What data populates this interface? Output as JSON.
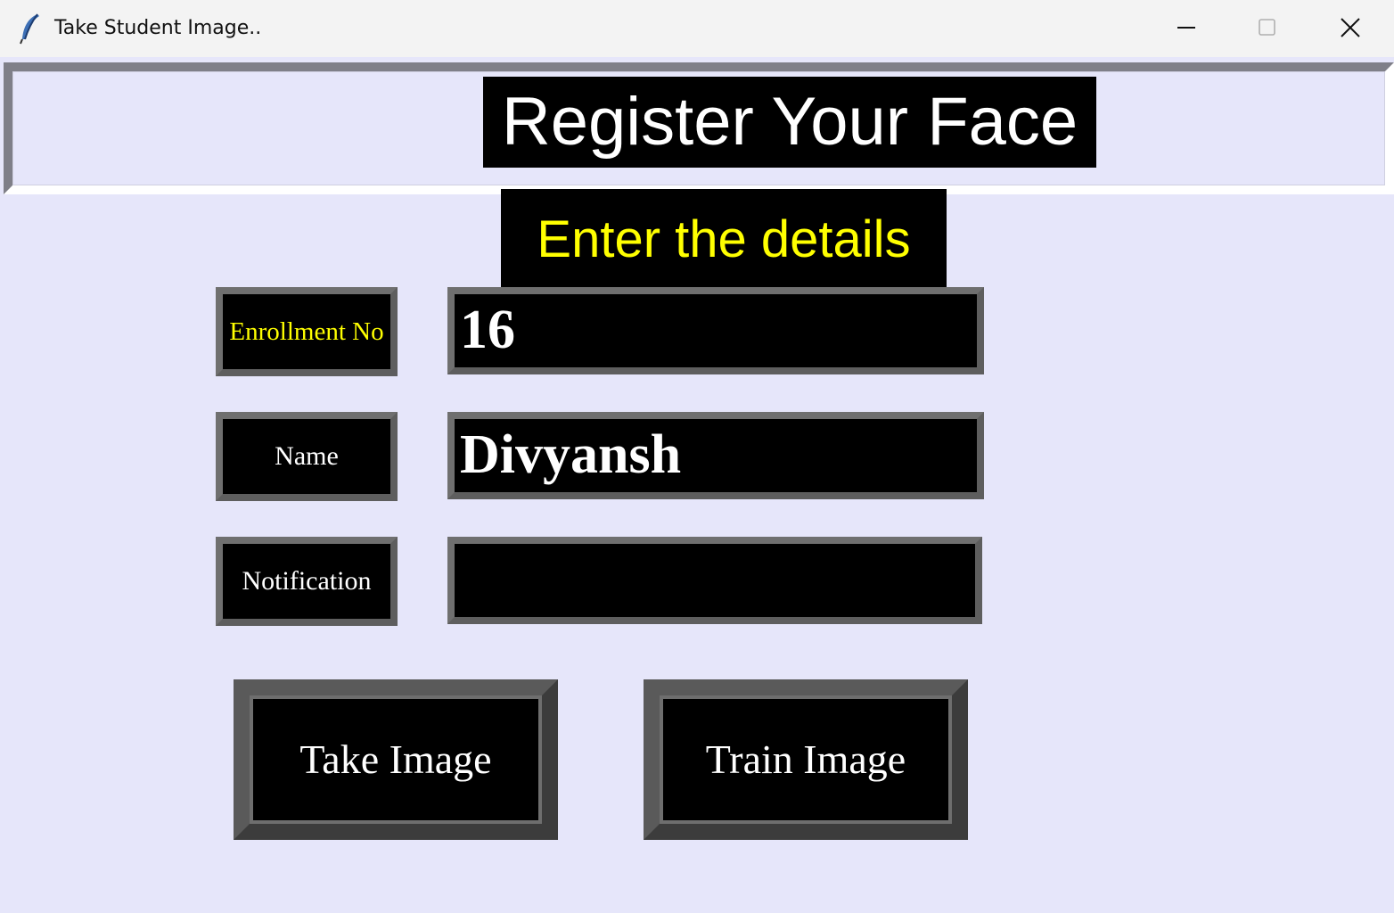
{
  "window": {
    "title": "Take Student Image..",
    "app_icon": "feather-icon",
    "controls": [
      "minimize-icon",
      "maximize-icon",
      "close-icon"
    ]
  },
  "header": {
    "title": "Register Your Face"
  },
  "subtitle": "Enter the details",
  "form": {
    "enrollment": {
      "label": "Enrollment No",
      "value": "16"
    },
    "name": {
      "label": "Name",
      "value": "Divyansh"
    },
    "notification": {
      "label": "Notification",
      "value": ""
    }
  },
  "buttons": {
    "take_image": "Take Image",
    "train_image": "Train Image"
  },
  "colors": {
    "background": "#e6e6fa",
    "box_bg": "#000000",
    "accent_yellow": "#ffff00",
    "text_white": "#ffffff"
  }
}
